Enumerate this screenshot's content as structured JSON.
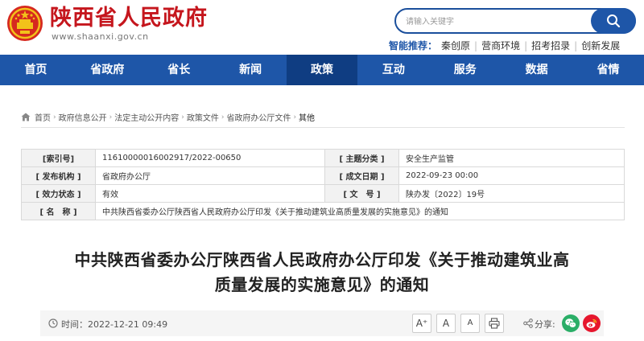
{
  "header": {
    "site_title": "陕西省人民政府",
    "site_url": "www.shaanxi.gov.cn",
    "search_placeholder": "请输入关键字",
    "smart_rec_label": "智能推荐：",
    "smart_rec_items": [
      "秦创原",
      "营商环境",
      "招考招录",
      "创新发展"
    ]
  },
  "nav": {
    "items": [
      "首页",
      "省政府",
      "省长",
      "新闻",
      "政策",
      "互动",
      "服务",
      "数据",
      "省情"
    ],
    "active": "政策"
  },
  "breadcrumb": [
    "首页",
    "政府信息公开",
    "法定主动公开内容",
    "政策文件",
    "省政府办公厅文件",
    "其他"
  ],
  "info": {
    "index_label": "[索引号]",
    "index_value": "11610000016002917/2022-00650",
    "category_label": "[ 主题分类 ]",
    "category_value": "安全生产监管",
    "issuer_label": "[ 发布机构 ]",
    "issuer_value": "省政府办公厅",
    "date_label": "[ 成文日期 ]",
    "date_value": "2022-09-23 00:00",
    "status_label": "[ 效力状态 ]",
    "status_value": "有效",
    "docno_label": "[ 文　号 ]",
    "docno_value": "陕办发〔2022〕19号",
    "name_label": "[ 名　称 ]",
    "name_value": "中共陕西省委办公厅陕西省人民政府办公厅印发《关于推动建筑业高质量发展的实施意见》的通知"
  },
  "article": {
    "title_line1": "中共陕西省委办公厅陕西省人民政府办公厅印发《关于推动建筑业高",
    "title_line2": "质量发展的实施意见》的通知",
    "time_text": "时间：2022-12-21 09:49",
    "font_larger": "A⁺",
    "font_normal": "A",
    "font_smaller": "A",
    "share_label": "分享:"
  },
  "colors": {
    "brand_red": "#c5161d",
    "nav_blue": "#1e56a8",
    "nav_active": "#0f3d82",
    "wechat_green": "#2aae67",
    "weibo_red": "#e6162d"
  }
}
